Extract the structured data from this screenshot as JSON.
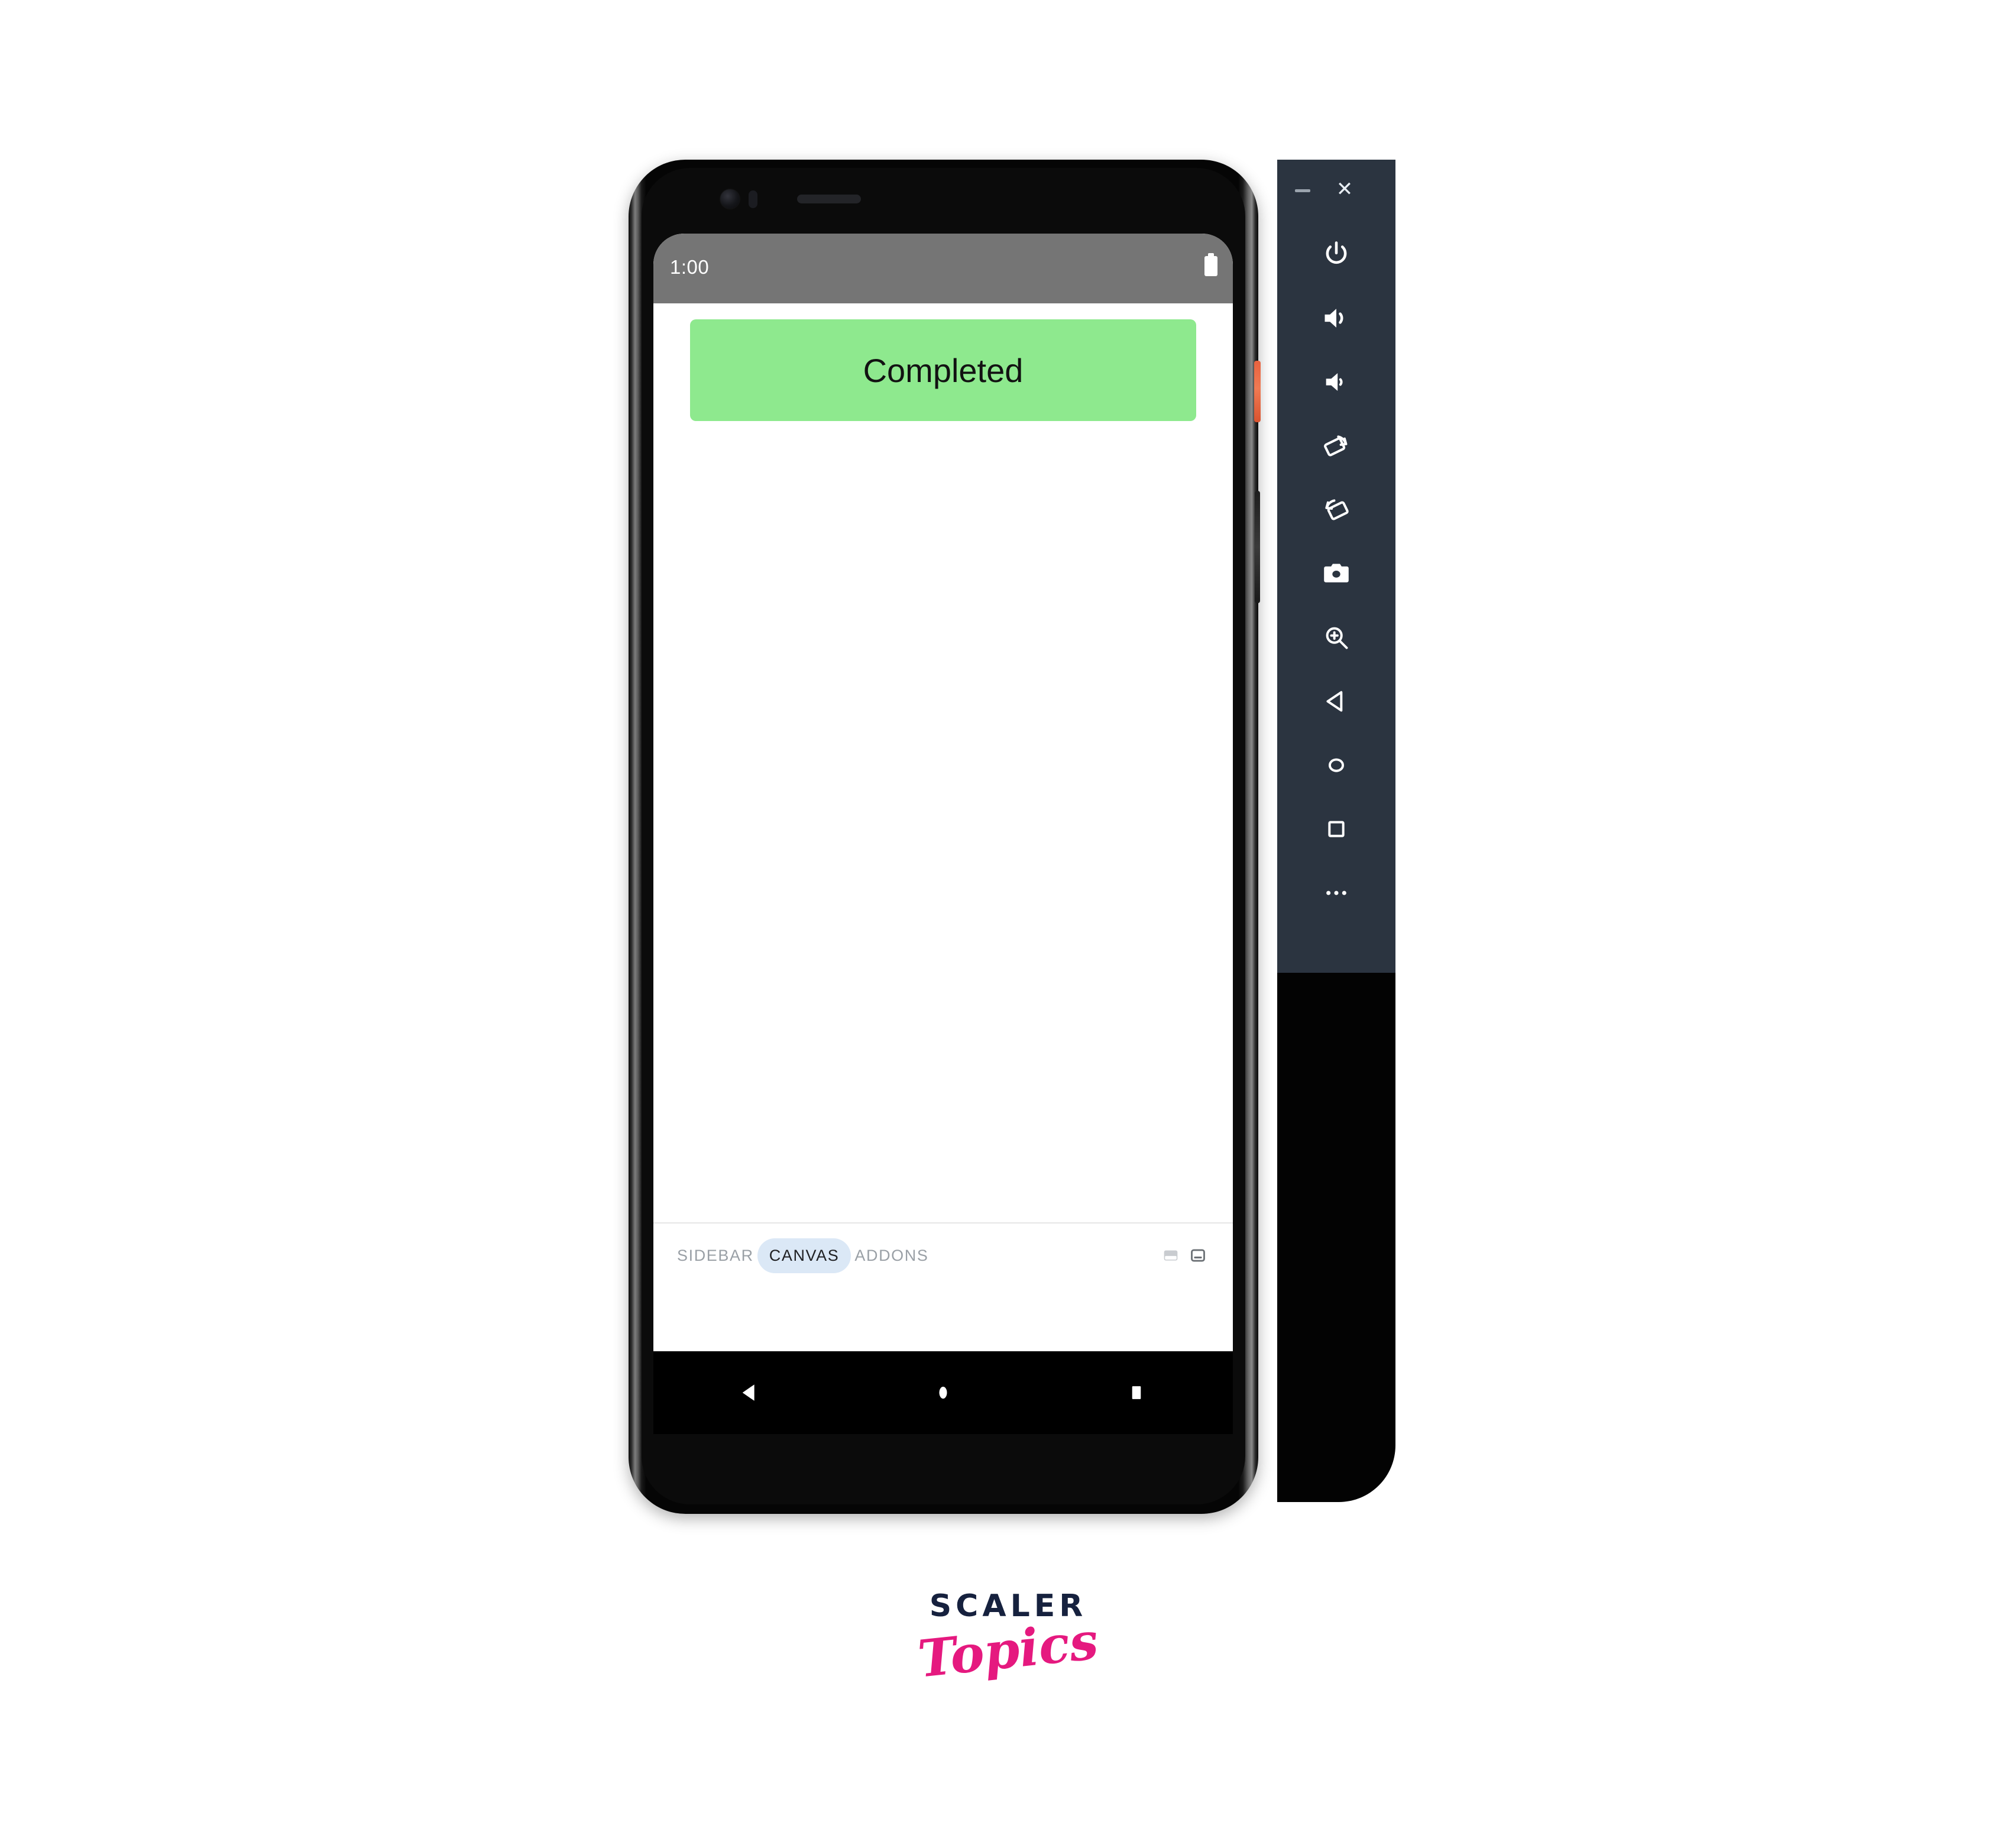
{
  "emulator": {
    "window_controls": [
      {
        "name": "minimize",
        "glyph": "–"
      },
      {
        "name": "close",
        "glyph": "×"
      }
    ],
    "toolbar_buttons": [
      {
        "icon": "power-icon",
        "label": "Power"
      },
      {
        "icon": "volume-up-icon",
        "label": "Volume Up"
      },
      {
        "icon": "volume-down-icon",
        "label": "Volume Down"
      },
      {
        "icon": "rotate-left-icon",
        "label": "Rotate Left"
      },
      {
        "icon": "rotate-right-icon",
        "label": "Rotate Right"
      },
      {
        "icon": "camera-icon",
        "label": "Take Screenshot"
      },
      {
        "icon": "zoom-in-icon",
        "label": "Zoom Mode"
      },
      {
        "icon": "back-icon",
        "label": "Back"
      },
      {
        "icon": "home-icon",
        "label": "Home"
      },
      {
        "icon": "overview-icon",
        "label": "Overview"
      },
      {
        "icon": "more-icon",
        "label": "Extended Controls"
      }
    ],
    "panel_color": "#2b3440",
    "body_color": "#030303"
  },
  "phone": {
    "frame_color": "#0b0b0b",
    "power_key_color": "#e8623f",
    "hardware": [
      {
        "icon": "front-camera-icon"
      },
      {
        "icon": "proximity-sensor-icon"
      },
      {
        "icon": "earpiece-speaker-icon"
      },
      {
        "icon": "power-key"
      },
      {
        "icon": "volume-key"
      }
    ]
  },
  "status_bar": {
    "time": "1:00",
    "battery_icon": "battery-icon",
    "background": "#757575",
    "foreground": "#ffffff"
  },
  "app": {
    "completed_button": {
      "label": "Completed",
      "background": "#8ee98e",
      "text_color": "#121212"
    }
  },
  "tool_strip": {
    "tabs": [
      {
        "label": "SIDEBAR",
        "active": false
      },
      {
        "label": "CANVAS",
        "active": true
      },
      {
        "label": "ADDONS",
        "active": false
      }
    ],
    "active_pill_color": "#dbe8f6",
    "right_icons": [
      {
        "icon": "layout-tablet-icon",
        "active": false
      },
      {
        "icon": "layout-phone-icon",
        "active": true
      }
    ]
  },
  "nav_bar": {
    "keys": [
      {
        "icon": "nav-back-icon"
      },
      {
        "icon": "nav-home-icon"
      },
      {
        "icon": "nav-recents-icon"
      }
    ],
    "background": "#000000"
  },
  "logo": {
    "primary": "SCALER",
    "secondary": "Topics",
    "primary_color": "#16213e",
    "secondary_color": "#e5197f"
  }
}
